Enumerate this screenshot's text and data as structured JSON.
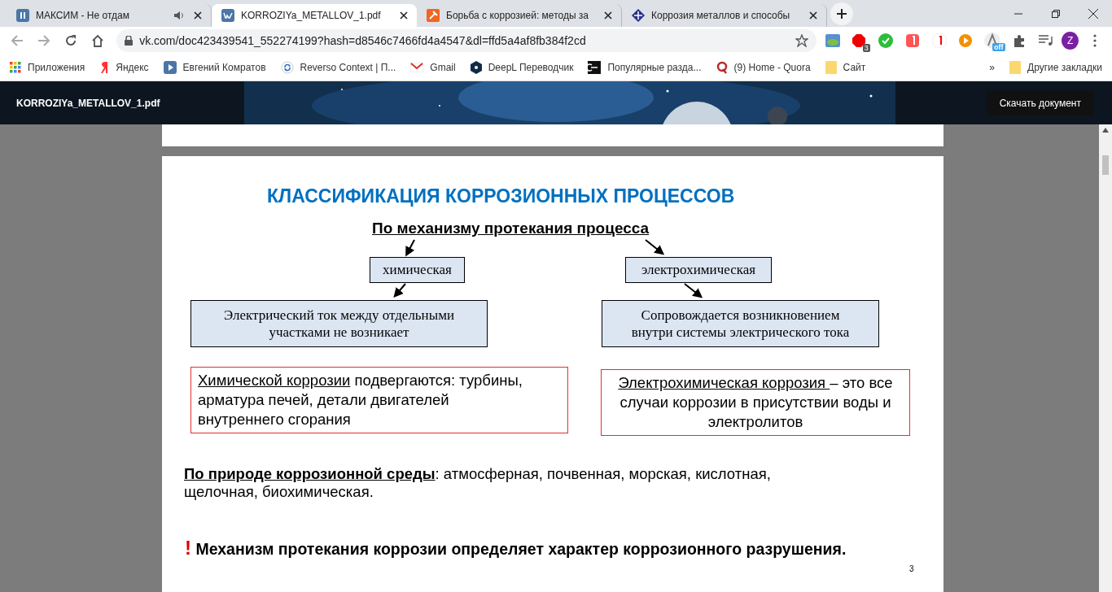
{
  "browser": {
    "tabs": [
      {
        "title": "МАКСИМ - Не отдам",
        "kind": "music",
        "selected": false,
        "audio": true
      },
      {
        "title": "KORROZIYa_METALLOV_1.pdf",
        "kind": "vk",
        "selected": true,
        "audio": false
      },
      {
        "title": "Борьба с коррозией: методы за",
        "kind": "hammer",
        "selected": false,
        "audio": false
      },
      {
        "title": "Коррозия металлов и способы",
        "kind": "cross",
        "selected": false,
        "audio": false
      }
    ],
    "address": "vk.com/doc423439541_552274199?hash=d8546c7466fd4a4547&dl=ffd5a4af8fb384f2cd",
    "extension_badge": "3",
    "extension_off_label": "off",
    "profile_initial": "Z",
    "bookmarks": [
      {
        "title": "Приложения",
        "kind": "apps"
      },
      {
        "title": "Яндекс",
        "kind": "yandex"
      },
      {
        "title": "Евгений Комратов",
        "kind": "play"
      },
      {
        "title": "Reverso Context | П...",
        "kind": "reverso"
      },
      {
        "title": "Gmail",
        "kind": "gmail"
      },
      {
        "title": "DeepL Переводчик",
        "kind": "deepl"
      },
      {
        "title": "Популярные разда...",
        "kind": "square"
      },
      {
        "title": "(9) Home - Quora",
        "kind": "quora"
      },
      {
        "title": "Сайт",
        "kind": "folder"
      }
    ],
    "bookmarks_overflow": "»",
    "other_bookmarks": "Другие закладки"
  },
  "viewer": {
    "file_name": "KORROZIYa_METALLOV_1.pdf",
    "download_button": "Скачать документ"
  },
  "slide": {
    "title": "КЛАССИФИКАЦИЯ КОРРОЗИОННЫХ ПРОЦЕССОВ",
    "subheading": "По механизму протекания процесса",
    "types": [
      {
        "label": "химическая",
        "description": "Электрический ток между отдельными участками не возникает",
        "note_lead": "Химической коррозии",
        "note_text": " подвергаются: турбины, арматура печей, детали двигателей внутреннего сгорания"
      },
      {
        "label": "электрохимическая",
        "description": "Сопровождается возникновением внутри системы электрического тока",
        "note_lead": "Электрохимическая коррозия ",
        "note_text": "– это все случаи коррозии в присутствии воды и электролитов"
      }
    ],
    "medium_lead": "По природе коррозионной среды",
    "medium_text": ": атмосферная, почвенная, морская, кислотная, щелочная, биохимическая.",
    "conclusion_mark": "!",
    "conclusion": " Механизм протекания коррозии определяет характер коррозионного разрушения.",
    "page_number": "3"
  }
}
